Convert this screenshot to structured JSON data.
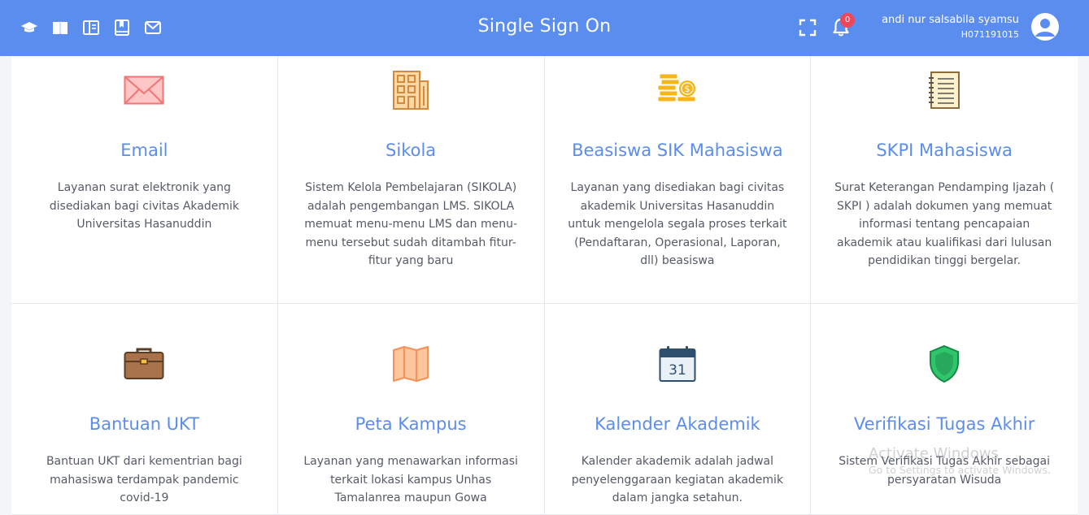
{
  "header": {
    "title": "Single Sign On",
    "notification_count": "0",
    "user_name": "andi nur salsabila syamsu",
    "user_id": "H071191015",
    "accent_color": "#5b8def",
    "nav_icons": [
      "graduation-cap-icon",
      "book-open-icon",
      "columns-book-icon",
      "bookmark-book-icon",
      "envelope-icon"
    ]
  },
  "services": [
    {
      "title": "Email",
      "description": "Layanan surat elektronik yang disediakan bagi civitas Akademik Universitas Hasanuddin",
      "icon": "envelope-icon"
    },
    {
      "title": "Sikola",
      "description": "Sistem Kelola Pembelajaran (SIKOLA) adalah pengembangan LMS. SIKOLA memuat menu-menu LMS dan menu-menu tersebut sudah ditambah fitur-fitur yang baru",
      "icon": "building-icon"
    },
    {
      "title": "Beasiswa SIK Mahasiswa",
      "description": "Layanan yang disediakan bagi civitas akademik Universitas Hasanuddin untuk mengelola segala proses terkait (Pendaftaran, Operasional, Laporan, dll) beasiswa",
      "icon": "coins-icon"
    },
    {
      "title": "SKPI Mahasiswa",
      "description": "Surat Keterangan Pendamping Ijazah ( SKPI ) adalah dokumen yang memuat informasi tentang pencapaian akademik atau kualifikasi dari lulusan pendidikan tinggi bergelar.",
      "icon": "notebook-icon"
    },
    {
      "title": "Bantuan UKT",
      "description": "Bantuan UKT dari kementrian bagi mahasiswa terdampak pandemic covid-19",
      "icon": "briefcase-icon"
    },
    {
      "title": "Peta Kampus",
      "description": "Layanan yang menawarkan informasi terkait lokasi kampus Unhas Tamalanrea maupun Gowa",
      "icon": "map-icon"
    },
    {
      "title": "Kalender Akademik",
      "description": "Kalender akademik adalah jadwal penyelenggaraan kegiatan akademik dalam jangka setahun.",
      "icon": "calendar-icon",
      "calendar_day": "31"
    },
    {
      "title": "Verifikasi Tugas Akhir",
      "description": "Sistem Verifikasi Tugas Akhir sebagai persyaratan Wisuda",
      "icon": "shield-icon"
    }
  ],
  "watermark": {
    "line1": "Activate Windows",
    "line2": "Go to Settings to activate Windows."
  }
}
